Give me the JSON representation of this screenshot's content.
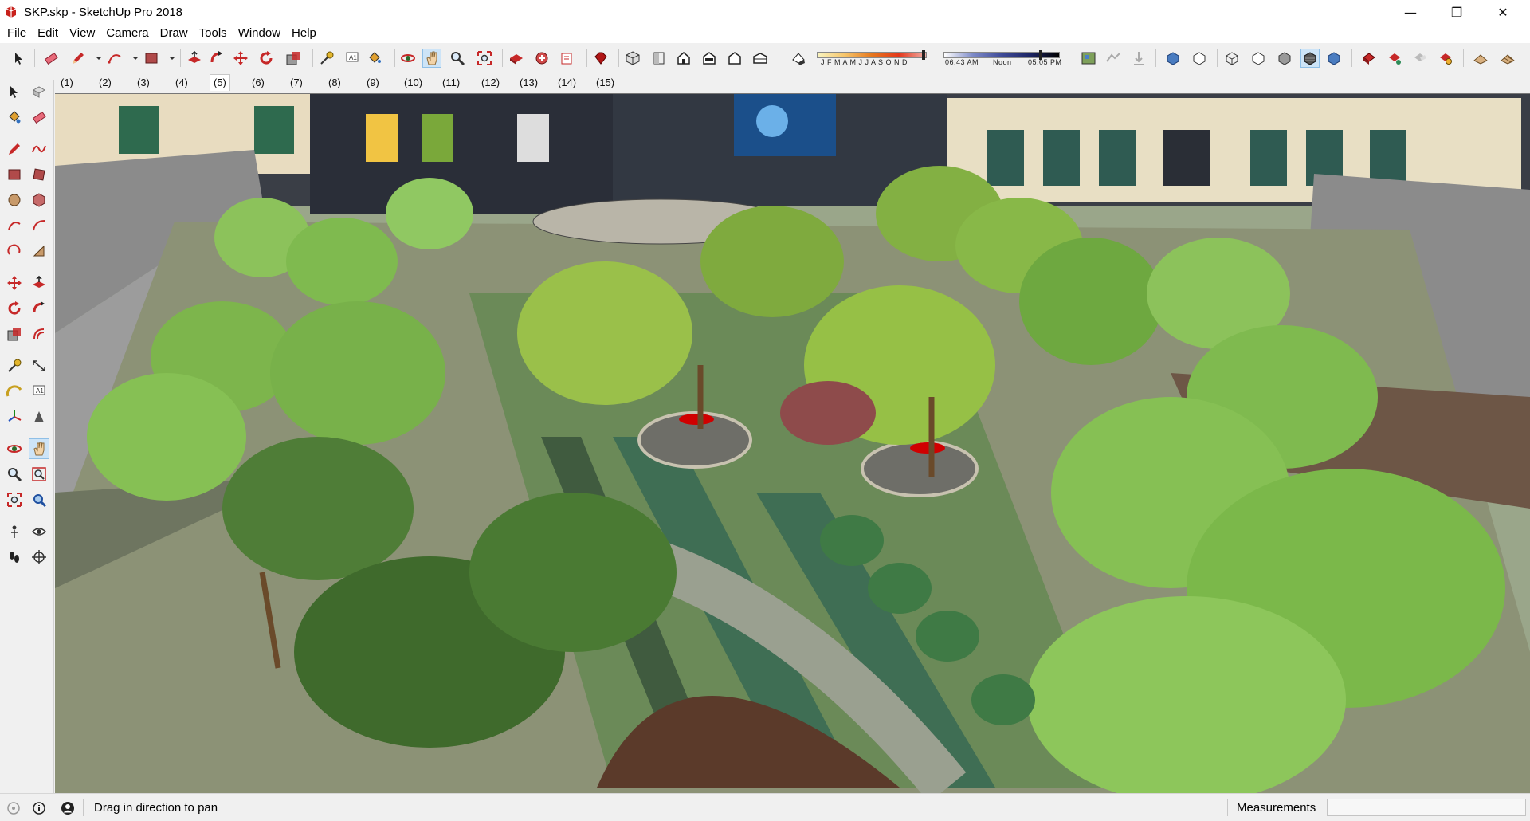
{
  "window": {
    "title": "SKP.skp - SketchUp Pro 2018",
    "minimize_icon": "—",
    "restore_icon": "❐",
    "close_icon": "✕"
  },
  "menu": [
    "File",
    "Edit",
    "View",
    "Camera",
    "Draw",
    "Tools",
    "Window",
    "Help"
  ],
  "toolbar": {
    "months_label": "J F M A M J J A S O N D",
    "time_start": "06:43 AM",
    "time_mid": "Noon",
    "time_end": "05:05 PM"
  },
  "scenes": {
    "tabs": [
      "(1)",
      "(2)",
      "(3)",
      "(4)",
      "(5)",
      "(6)",
      "(7)",
      "(8)",
      "(9)",
      "(10)",
      "(11)",
      "(12)",
      "(13)",
      "(14)",
      "(15)"
    ],
    "active_index": 4
  },
  "status": {
    "hint": "Drag in direction to pan",
    "measurements_label": "Measurements",
    "measurements_value": ""
  },
  "colors": {
    "accent": "#cde4f7",
    "sketchup_red": "#c8211b"
  }
}
